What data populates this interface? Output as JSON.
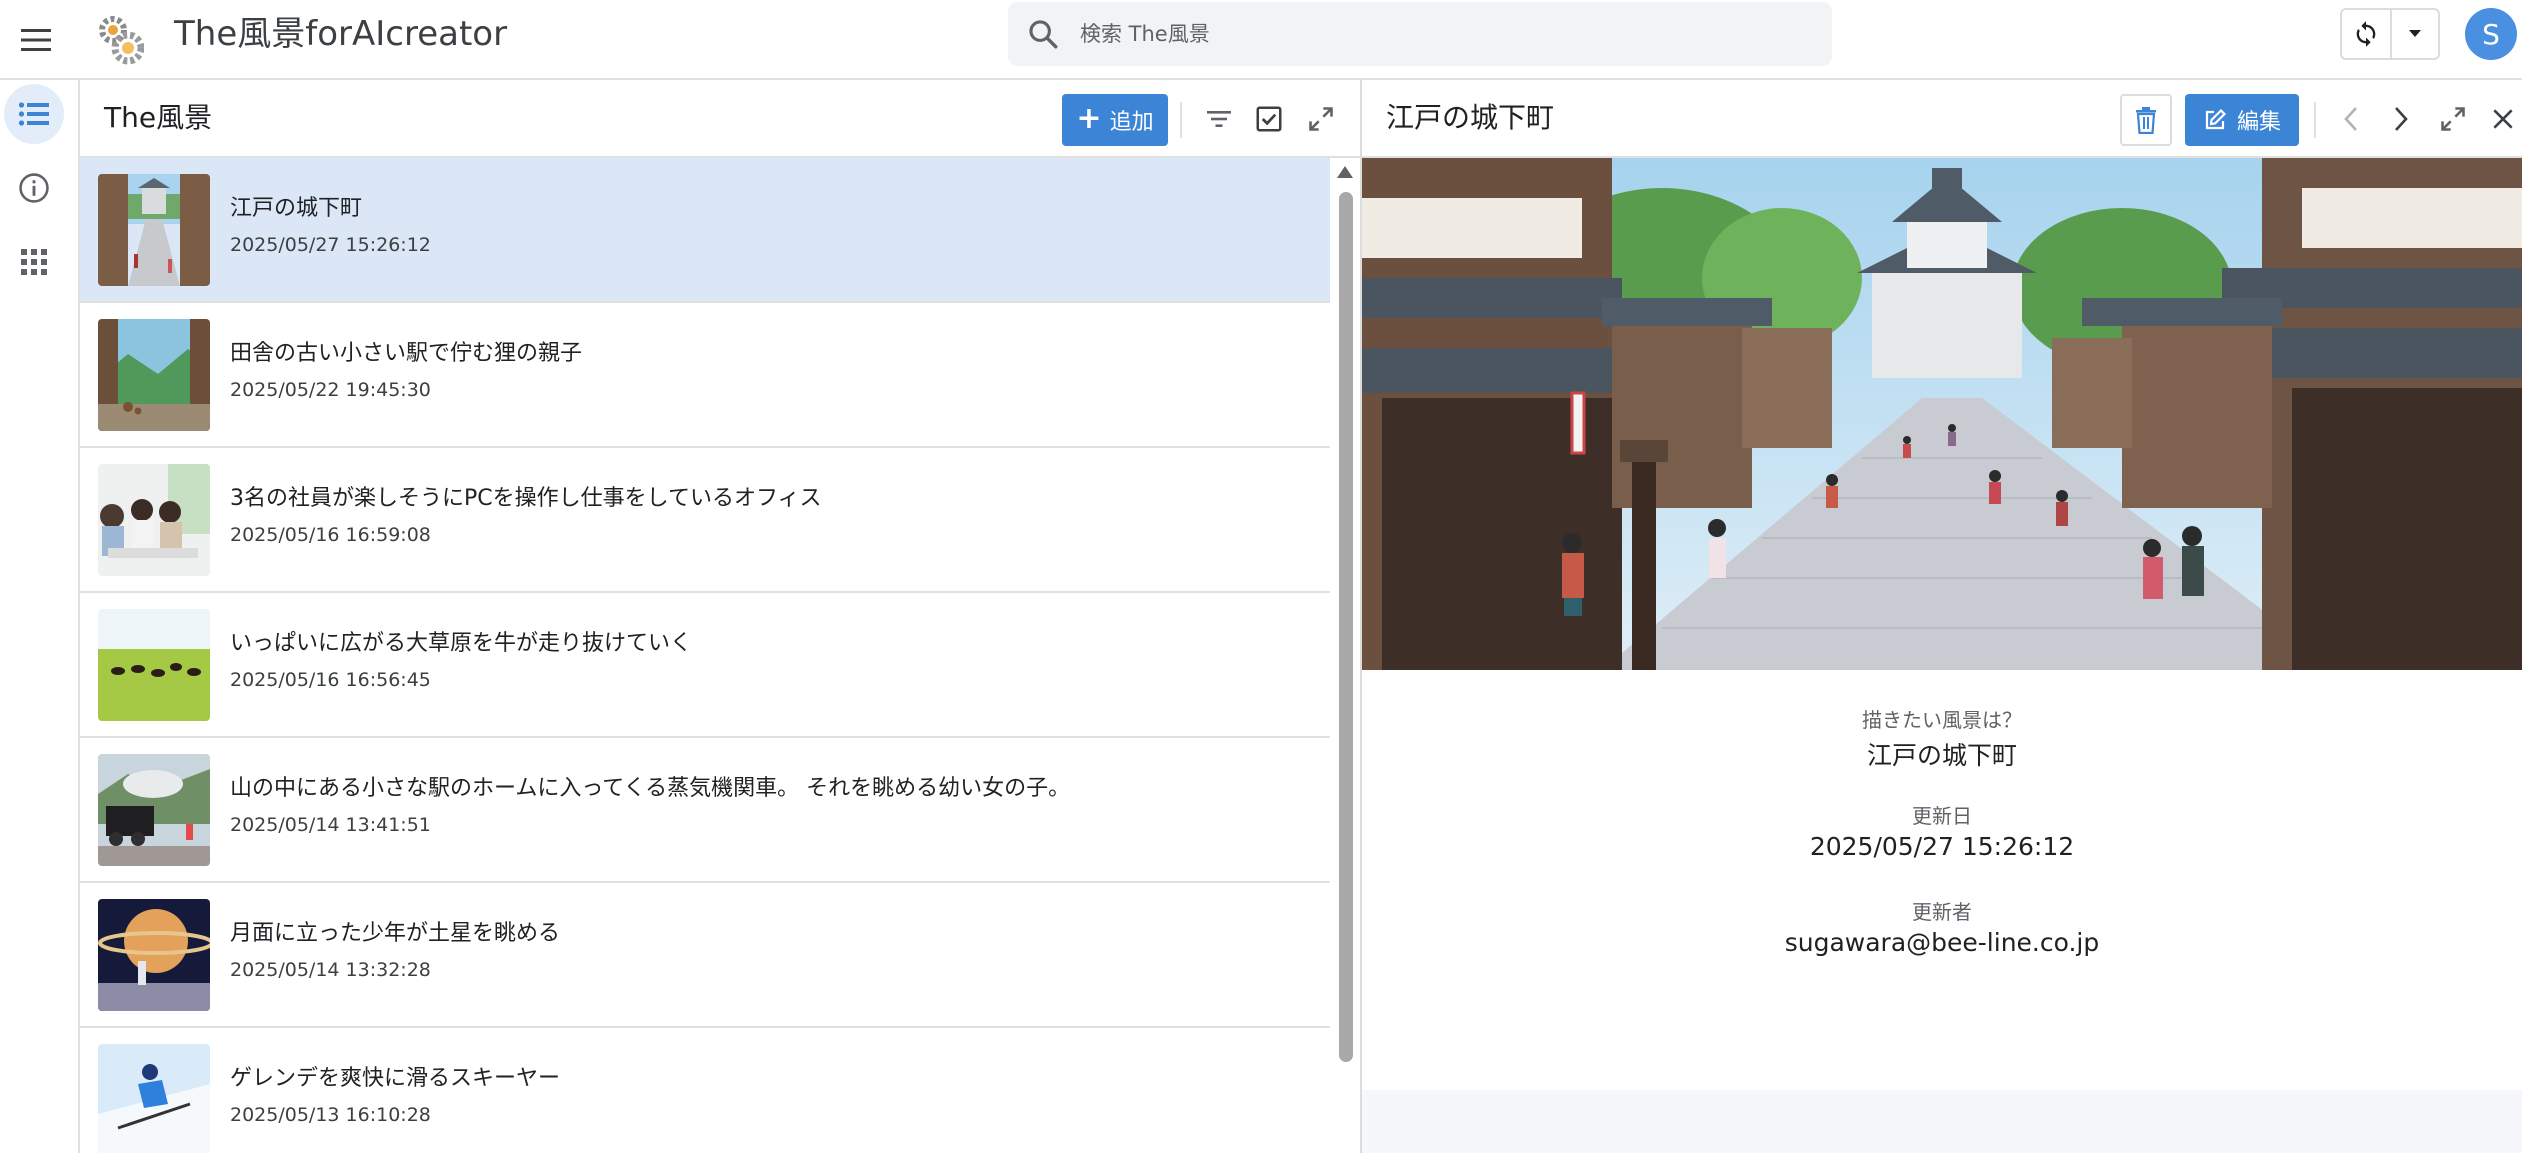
{
  "app": {
    "title": "The風景forAIcreator",
    "avatar_initial": "S",
    "colors": {
      "accent": "#3b84d6",
      "selected_row": "#dbe7f6",
      "avatar": "#4a8fe0"
    }
  },
  "search": {
    "placeholder": "検索 The風景"
  },
  "rail": {
    "items": [
      "list-icon",
      "info-icon",
      "apps-icon"
    ]
  },
  "list_panel": {
    "title": "The風景",
    "add_label": "追加",
    "items": [
      {
        "title": "江戸の城下町",
        "date": "2025/05/27 15:26:12",
        "selected": true
      },
      {
        "title": "田舎の古い小さい駅で佇む狸の親子",
        "date": "2025/05/22 19:45:30"
      },
      {
        "title": "3名の社員が楽しそうにPCを操作し仕事をしているオフィス",
        "date": "2025/05/16 16:59:08"
      },
      {
        "title": "いっぱいに広がる大草原を牛が走り抜けていく",
        "date": "2025/05/16 16:56:45"
      },
      {
        "title": "山の中にある小さな駅のホームに入ってくる蒸気機関車。 それを眺める幼い女の子。",
        "date": "2025/05/14 13:41:51"
      },
      {
        "title": "月面に立った少年が土星を眺める",
        "date": "2025/05/14 13:32:28"
      },
      {
        "title": "ゲレンデを爽快に滑るスキーヤー",
        "date": "2025/05/13 16:10:28"
      }
    ]
  },
  "detail": {
    "title": "江戸の城下町",
    "edit_label": "編集",
    "fields": [
      {
        "label": "描きたい風景は？",
        "value": "江戸の城下町"
      },
      {
        "label": "更新日",
        "value": "2025/05/27 15:26:12"
      },
      {
        "label": "更新者",
        "value": "sugawara@bee-line.co.jp"
      }
    ]
  }
}
